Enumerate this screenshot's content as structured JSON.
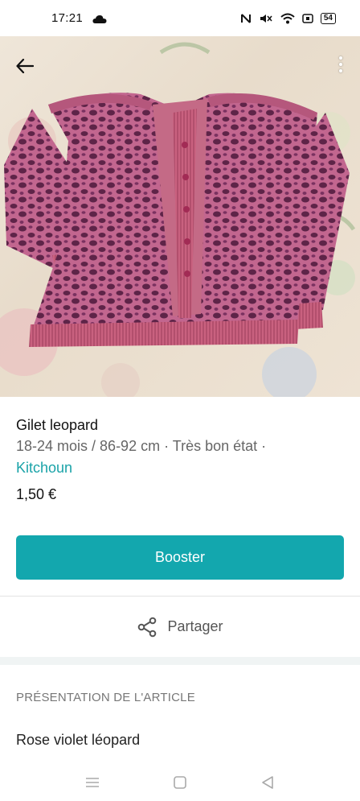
{
  "status_bar": {
    "time": "17:21",
    "battery": "54"
  },
  "item": {
    "title": "Gilet leopard",
    "meta": "18-24 mois / 86-92 cm · Très bon état ·",
    "brand": "Kitchoun",
    "price": "1,50 €"
  },
  "actions": {
    "booster_label": "Booster",
    "share_label": "Partager"
  },
  "section": {
    "heading": "PRÉSENTATION DE L'ARTICLE",
    "description": "Rose violet léopard"
  },
  "colors": {
    "accent": "#13a7ae",
    "brand_link": "#1aa3a8"
  },
  "icons": {
    "back": "arrow-left-icon",
    "more": "more-vertical-icon",
    "share": "share-icon",
    "nav_menu": "menu-icon",
    "nav_home": "home-square-icon",
    "nav_back": "back-triangle-icon"
  }
}
